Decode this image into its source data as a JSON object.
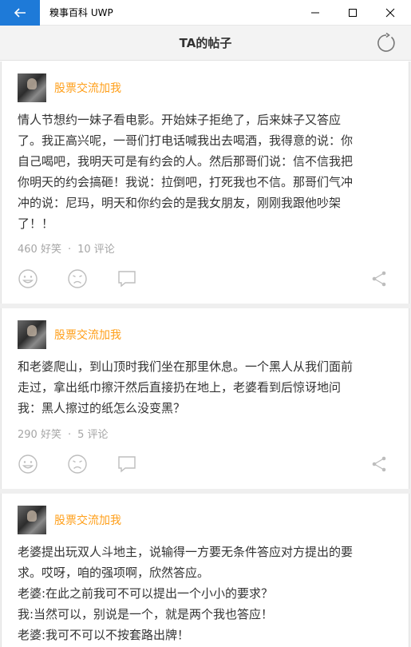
{
  "window": {
    "title": "糗事百科 UWP"
  },
  "header": {
    "title": "TA的帖子"
  },
  "posts": [
    {
      "author": "股票交流加我",
      "lines": [
        "情人节想约一妹子看电影。开始妹子拒绝了，后来妹子又答应",
        "了。我正高兴呢，一哥们打电话喊我出去喝酒，我得意的说：你",
        "自己喝吧，我明天可是有约会的人。然后那哥们说：信不信我把",
        "你明天的约会搞砸！我说：拉倒吧，打死我也不信。那哥们气冲",
        "冲的说：尼玛，明天和你约会的是我女朋友，刚刚我跟他吵架",
        "了！！"
      ],
      "likes": "460 好笑",
      "dot": "·",
      "comments": "10 评论"
    },
    {
      "author": "股票交流加我",
      "lines": [
        "和老婆爬山，到山顶时我们坐在那里休息。一个黑人从我们面前",
        "走过，拿出纸巾擦汗然后直接扔在地上，老婆看到后惊讶地问",
        "我：黑人擦过的纸怎么没变黑？"
      ],
      "likes": "290 好笑",
      "dot": "·",
      "comments": "5 评论"
    },
    {
      "author": "股票交流加我",
      "lines": [
        "老婆提出玩双人斗地主，说输得一方要无条件答应对方提出的要",
        "求。哎呀，咱的强项啊，欣然答应。",
        "老婆:在此之前我可不可以提出一个小小的要求？",
        "我:当然可以，别说是一个，就是两个我也答应！",
        "老婆:我可不可以不按套路出牌！"
      ]
    }
  ]
}
